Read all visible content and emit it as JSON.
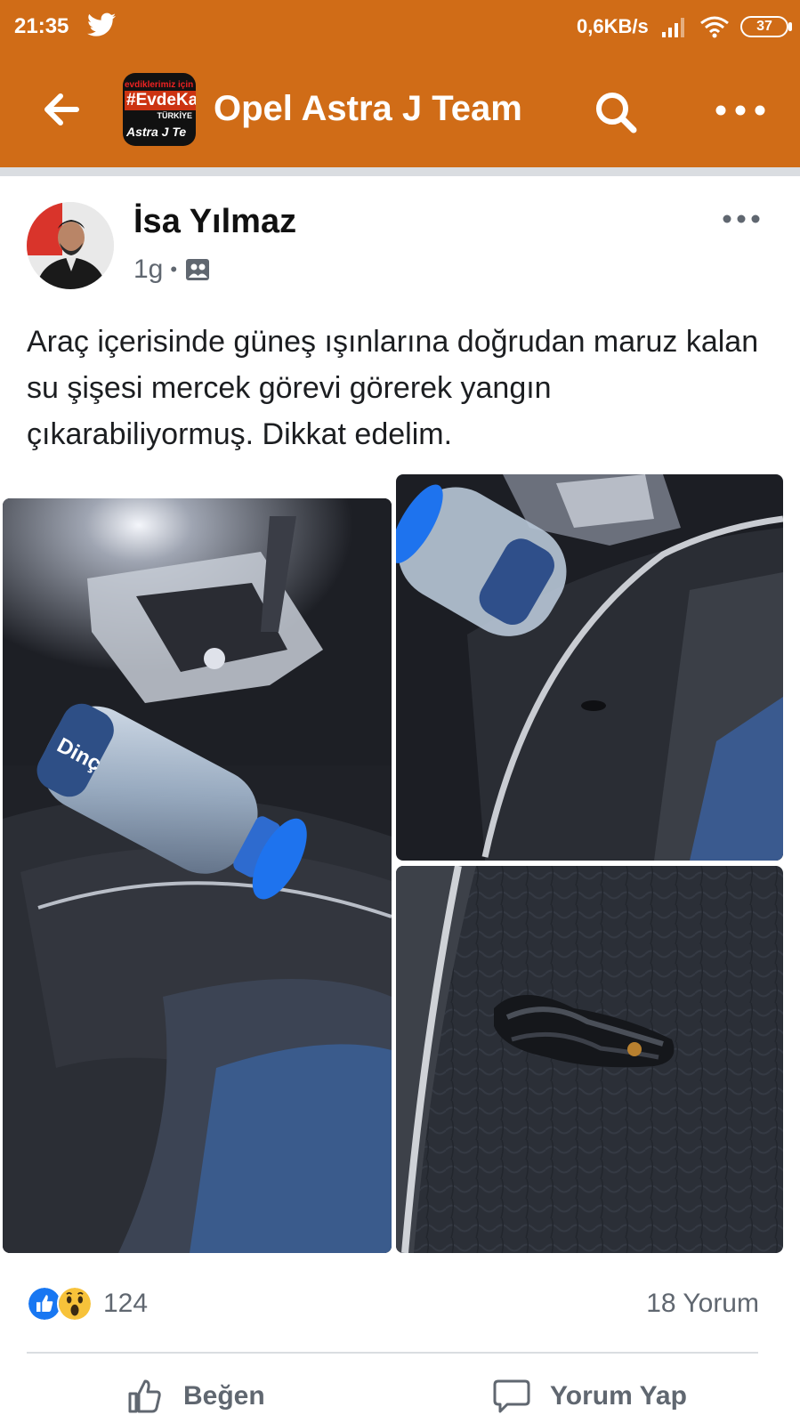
{
  "status_bar": {
    "time": "21:35",
    "network_speed": "0,6KB/s",
    "battery": "37",
    "icons": [
      "twitter-icon",
      "signal-icon",
      "wifi-icon",
      "battery-icon"
    ]
  },
  "app_bar": {
    "title": "Opel Astra J Team",
    "logo_text": {
      "line1": "evdiklerimiz için",
      "line2": "#EvdeKal",
      "line3": "TÜRKİYE",
      "line4": "Astra J Te"
    },
    "icons": [
      "back-arrow-icon",
      "search-icon",
      "more-icon"
    ]
  },
  "post": {
    "author": "İsa Yılmaz",
    "time": "1g",
    "separator": "•",
    "audience_icon": "group-icon",
    "text": "Araç içerisinde güneş ışınlarına doğrudan maruz kalan su şişesi mercek görevi görerek yangın çıkarabiliyormuş. Dikkat edelim.",
    "photos": [
      {
        "name": "water-bottle-on-armrest-photo",
        "bottle_label": "Dinç"
      },
      {
        "name": "bottle-in-cupholder-photo"
      },
      {
        "name": "burned-leather-closeup-photo"
      }
    ]
  },
  "reactions": {
    "icons": [
      "like-reaction-icon",
      "wow-reaction-icon"
    ],
    "count": "124",
    "comments": "18 Yorum"
  },
  "actions": {
    "like_label": "Beğen",
    "comment_label": "Yorum Yap"
  },
  "colors": {
    "brand": "#d06c17",
    "like_blue": "#1877f2",
    "wow_yellow": "#f7c23a",
    "secondary_text": "#606770"
  }
}
